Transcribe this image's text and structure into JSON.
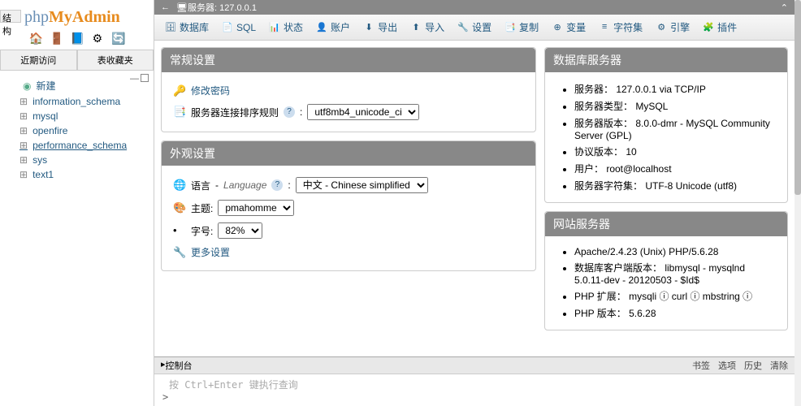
{
  "left": {
    "struct_tab": "结构",
    "logo": {
      "p1": "php",
      "p2": "MyAdmin",
      "p3": ""
    },
    "tabs": [
      "近期访问",
      "表收藏夹"
    ],
    "new_label": "新建",
    "databases": [
      "information_schema",
      "mysql",
      "openfire",
      "performance_schema",
      "sys",
      "text1"
    ],
    "selected_db": "performance_schema"
  },
  "topbar": {
    "arrow": "←",
    "server_label": "服务器: 127.0.0.1"
  },
  "toolbar": [
    {
      "icon": "🗄",
      "label": "数据库"
    },
    {
      "icon": "📄",
      "label": "SQL"
    },
    {
      "icon": "📊",
      "label": "状态"
    },
    {
      "icon": "👤",
      "label": "账户"
    },
    {
      "icon": "⬇",
      "label": "导出"
    },
    {
      "icon": "⬆",
      "label": "导入"
    },
    {
      "icon": "🔧",
      "label": "设置"
    },
    {
      "icon": "📑",
      "label": "复制"
    },
    {
      "icon": "⊕",
      "label": "变量"
    },
    {
      "icon": "≡",
      "label": "字符集"
    },
    {
      "icon": "⚙",
      "label": "引擎"
    },
    {
      "icon": "🧩",
      "label": "插件"
    }
  ],
  "panels": {
    "general": {
      "title": "常规设置",
      "change_pw": "修改密码",
      "collation_label": "服务器连接排序规则",
      "collation_value": "utf8mb4_unicode_ci"
    },
    "appearance": {
      "title": "外观设置",
      "lang_label": "语言",
      "lang_italic": "Language",
      "lang_value": "中文 - Chinese simplified",
      "theme_label": "主题:",
      "theme_value": "pmahomme",
      "fontsize_label": "字号:",
      "fontsize_value": "82%",
      "more": "更多设置"
    },
    "dbserver": {
      "title": "数据库服务器",
      "items": [
        "服务器：  127.0.0.1 via TCP/IP",
        "服务器类型：  MySQL",
        "服务器版本：  8.0.0-dmr - MySQL Community Server (GPL)",
        "协议版本：  10",
        "用户：  root@localhost",
        "服务器字符集：  UTF-8 Unicode (utf8)"
      ]
    },
    "webserver": {
      "title": "网站服务器",
      "items": [
        "Apache/2.4.23 (Unix) PHP/5.6.28",
        "数据库客户端版本：  libmysql - mysqlnd 5.0.11-dev - 20120503 - $Id$",
        "PHP 扩展：  mysqli ⓘ curl ⓘ mbstring ⓘ",
        "PHP 版本：  5.6.28"
      ]
    }
  },
  "console": {
    "toggle": "▸",
    "title": "控制台",
    "actions": [
      "书签",
      "选项",
      "历史",
      "清除"
    ],
    "hint": "按 Ctrl+Enter 键执行查询",
    "prompt": ">"
  }
}
